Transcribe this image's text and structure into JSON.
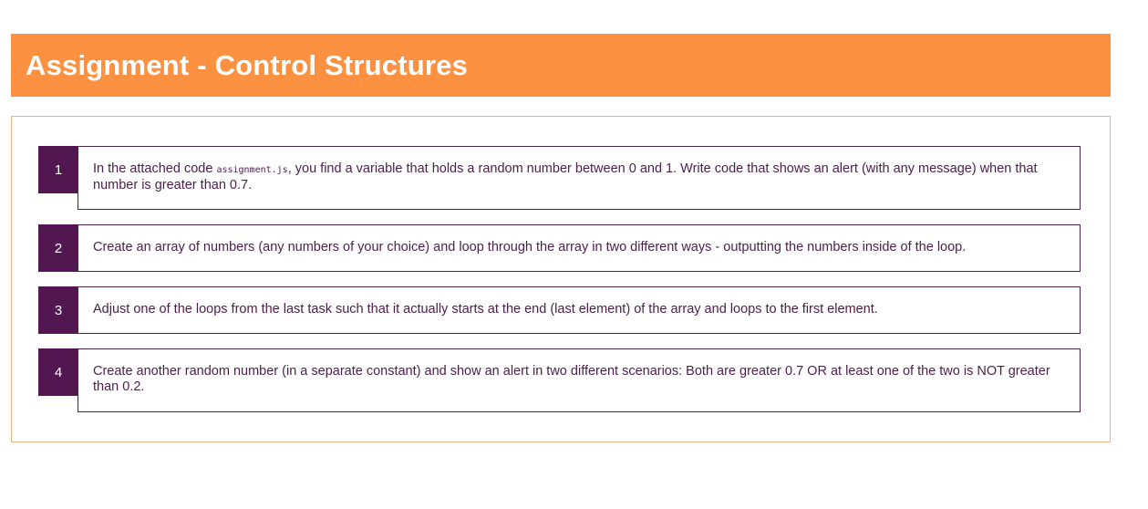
{
  "header": {
    "title": "Assignment - Control Structures"
  },
  "tasks": [
    {
      "number": "1",
      "text_before": "In the attached code ",
      "code": "assignment.js",
      "text_after": ", you find a variable that holds a random number between 0 and 1. Write code that shows an alert (with any message) when that number is greater than 0.7."
    },
    {
      "number": "2",
      "text": "Create an array of numbers (any numbers of your choice) and loop through the array in two different ways - outputting the numbers inside of the loop."
    },
    {
      "number": "3",
      "text": "Adjust one of the loops from the last task such that it actually starts at the end (last element) of the array and loops to the first element."
    },
    {
      "number": "4",
      "text": "Create another random number (in a separate constant) and show an alert in two different scenarios: Both are greater 0.7 OR at least one of the two is NOT greater than 0.2."
    }
  ],
  "colors": {
    "header_bg": "#fb9141",
    "accent_purple": "#521751",
    "panel_border": "#e9b27f",
    "text": "#4a1f49"
  }
}
